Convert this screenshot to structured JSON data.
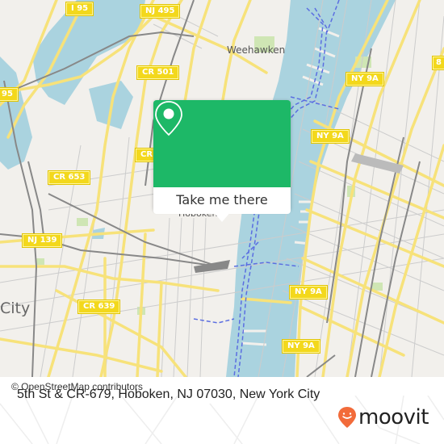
{
  "map": {
    "place_labels": [
      {
        "id": "weehawken",
        "text": "Weehawken"
      },
      {
        "id": "hoboken",
        "text": "Hoboken"
      },
      {
        "id": "city",
        "text": "City"
      }
    ],
    "road_shields": [
      {
        "id": "i95-top",
        "text": "I 95"
      },
      {
        "id": "nj495",
        "text": "NJ 495"
      },
      {
        "id": "cr501",
        "text": "CR 501"
      },
      {
        "id": "i95-left",
        "text": "95"
      },
      {
        "id": "cr653",
        "text": "CR 653"
      },
      {
        "id": "cr-partial",
        "text": "CR"
      },
      {
        "id": "nj139",
        "text": "NJ 139"
      },
      {
        "id": "cr639",
        "text": "CR 639"
      },
      {
        "id": "ny9a-1",
        "text": "NY 9A"
      },
      {
        "id": "ny9a-2",
        "text": "NY 9A"
      },
      {
        "id": "ny9a-3",
        "text": "NY 9A"
      },
      {
        "id": "ny9a-4",
        "text": "NY 9A"
      },
      {
        "id": "route8",
        "text": "8"
      }
    ],
    "attribution": "© OpenStreetMap contributors",
    "colors": {
      "land": "#f2f0ec",
      "water": "#aad3df",
      "road": "#f7e27a",
      "park": "#cfe6b4",
      "rail": "#888888",
      "ferry": "#5b6ee1"
    }
  },
  "popup": {
    "icon": "map-pin-icon",
    "button_label": "Take me there",
    "accent_color": "#1db867"
  },
  "footer": {
    "address": "5th St & CR-679, Hoboken, NJ 07030, New York City",
    "brand": "moovit",
    "brand_icon": "moovit-smiley-pin-icon",
    "brand_color": "#f26b3a"
  }
}
